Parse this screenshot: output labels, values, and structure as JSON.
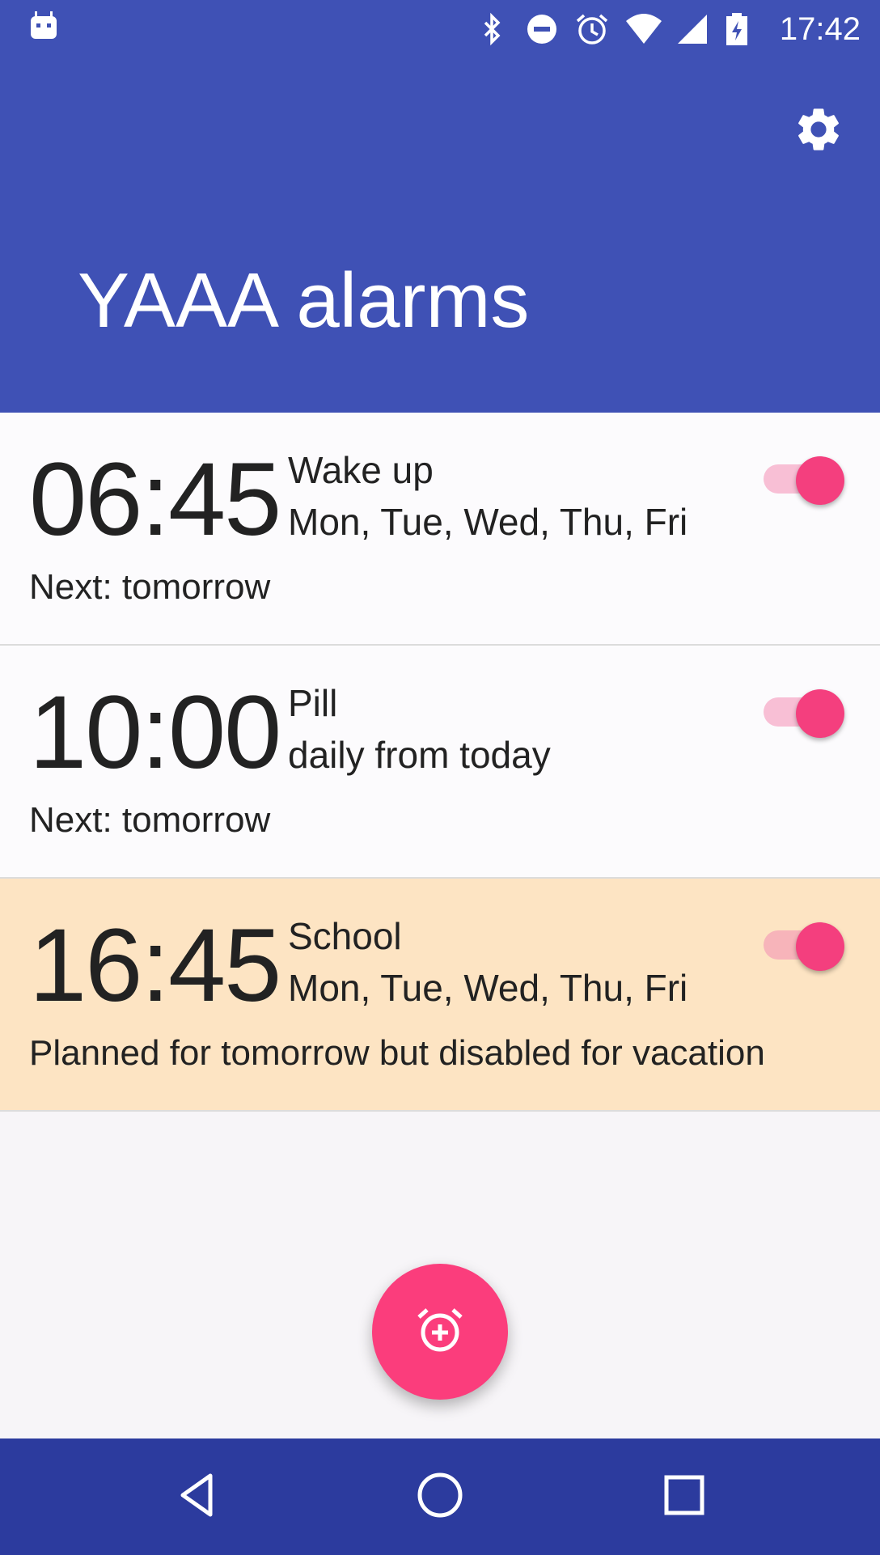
{
  "status_bar": {
    "time": "17:42",
    "icons": [
      "android-icon",
      "bluetooth-icon",
      "do-not-disturb-icon",
      "alarm-icon",
      "wifi-icon",
      "signal-icon",
      "battery-charging-icon"
    ]
  },
  "app_bar": {
    "title": "YAAA alarms",
    "settings_icon": "gear-icon"
  },
  "alarms": [
    {
      "time": "06:45",
      "label": "Wake up",
      "days": "Mon, Tue, Wed, Thu, Fri",
      "next": "Next: tomorrow",
      "enabled": true,
      "highlight": false
    },
    {
      "time": "10:00",
      "label": "Pill",
      "days": "daily from today",
      "next": "Next: tomorrow",
      "enabled": true,
      "highlight": false
    },
    {
      "time": "16:45",
      "label": "School",
      "days": "Mon, Tue, Wed, Thu, Fri",
      "next": "Planned for tomorrow but disabled for vacation",
      "enabled": true,
      "highlight": true
    }
  ],
  "fab": {
    "icon": "add-alarm-icon"
  },
  "nav_bar": {
    "icons": [
      "back-icon",
      "home-icon",
      "recents-icon"
    ]
  },
  "colors": {
    "primary": "#3f51b5",
    "primary_dark": "#2c3b9e",
    "accent": "#f43f7e",
    "vacation_bg": "#fde4c3"
  }
}
